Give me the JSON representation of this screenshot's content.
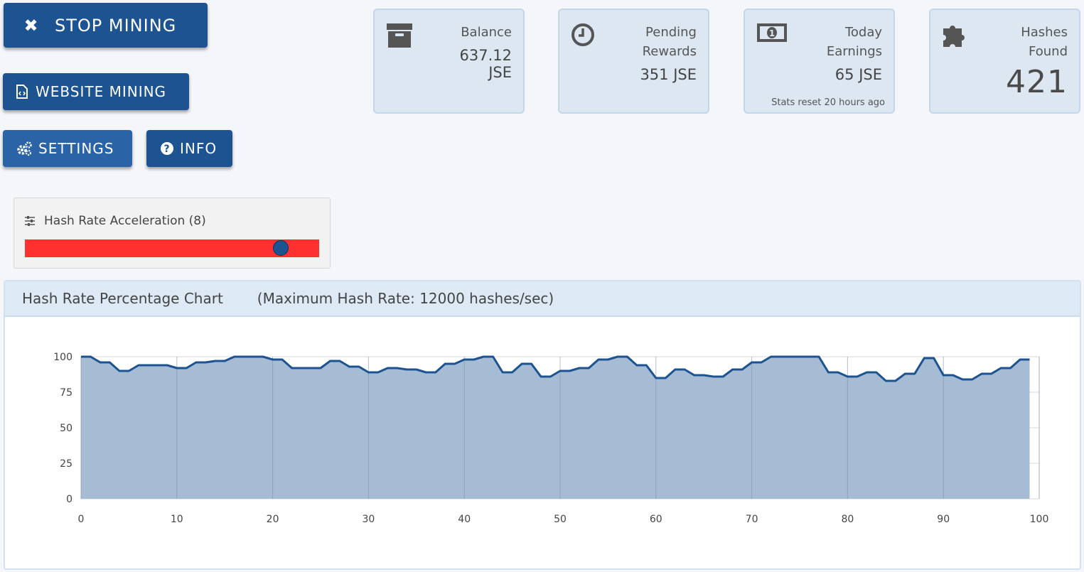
{
  "buttons": {
    "stop_mining": "STOP MINING",
    "website_mining": "WEBSITE MINING",
    "settings": "SETTINGS",
    "info": "INFO"
  },
  "stats": {
    "balance": {
      "label_line1": "Balance",
      "value_line1": "637.12",
      "value_line2": "JSE",
      "icon": "archive-icon"
    },
    "pending": {
      "label_line1": "Pending",
      "label_line2": "Rewards",
      "value": "351 JSE",
      "icon": "clock-icon"
    },
    "today": {
      "label_line1": "Today",
      "label_line2": "Earnings",
      "value": "65 JSE",
      "note": "Stats reset 20 hours ago",
      "icon": "money-icon"
    },
    "hashes": {
      "label_line1": "Hashes",
      "label_line2": "Found",
      "value": "421",
      "icon": "puzzle-icon"
    }
  },
  "slider": {
    "label": "Hash Rate Acceleration (8)",
    "level": 0.87,
    "track_color": "#ff3030",
    "thumb_color": "#1c5390"
  },
  "chart_panel": {
    "title": "Hash Rate Percentage Chart",
    "subtitle": "(Maximum Hash Rate: 12000 hashes/sec)"
  },
  "chart_data": {
    "type": "area",
    "x": [
      0,
      1,
      2,
      3,
      4,
      5,
      6,
      7,
      8,
      9,
      10,
      11,
      12,
      13,
      14,
      15,
      16,
      17,
      18,
      19,
      20,
      21,
      22,
      23,
      24,
      25,
      26,
      27,
      28,
      29,
      30,
      31,
      32,
      33,
      34,
      35,
      36,
      37,
      38,
      39,
      40,
      41,
      42,
      43,
      44,
      45,
      46,
      47,
      48,
      49,
      50,
      51,
      52,
      53,
      54,
      55,
      56,
      57,
      58,
      59,
      60,
      61,
      62,
      63,
      64,
      65,
      66,
      67,
      68,
      69,
      70,
      71,
      72,
      73,
      74,
      75,
      76,
      77,
      78,
      79,
      80,
      81,
      82,
      83,
      84,
      85,
      86,
      87,
      88,
      89,
      90,
      91,
      92,
      93,
      94,
      95,
      96,
      97,
      98,
      99
    ],
    "values": [
      100,
      100,
      96,
      96,
      90,
      90,
      94,
      94,
      94,
      94,
      92,
      92,
      96,
      96,
      97,
      97,
      100,
      100,
      100,
      100,
      98,
      98,
      92,
      92,
      92,
      92,
      97,
      97,
      93,
      93,
      89,
      89,
      92,
      92,
      91,
      91,
      89,
      89,
      95,
      95,
      98,
      98,
      100,
      100,
      89,
      89,
      95,
      95,
      86,
      86,
      90,
      90,
      92,
      92,
      98,
      98,
      100,
      100,
      94,
      94,
      85,
      85,
      91,
      91,
      87,
      87,
      86,
      86,
      91,
      91,
      96,
      96,
      100,
      100,
      100,
      100,
      100,
      100,
      89,
      89,
      86,
      86,
      89,
      89,
      83,
      83,
      88,
      88,
      99,
      99,
      87,
      87,
      84,
      84,
      88,
      88,
      92,
      92,
      98,
      98
    ],
    "xlim": [
      0,
      100
    ],
    "ylim": [
      0,
      100
    ],
    "xticks": [
      "0",
      "10",
      "20",
      "30",
      "40",
      "50",
      "60",
      "70",
      "80",
      "90",
      "100"
    ],
    "yticks": [
      "100",
      "75",
      "50",
      "25",
      "0"
    ],
    "grid": true,
    "line_color": "#1c5390",
    "fill_color": "#a6bcd4"
  }
}
